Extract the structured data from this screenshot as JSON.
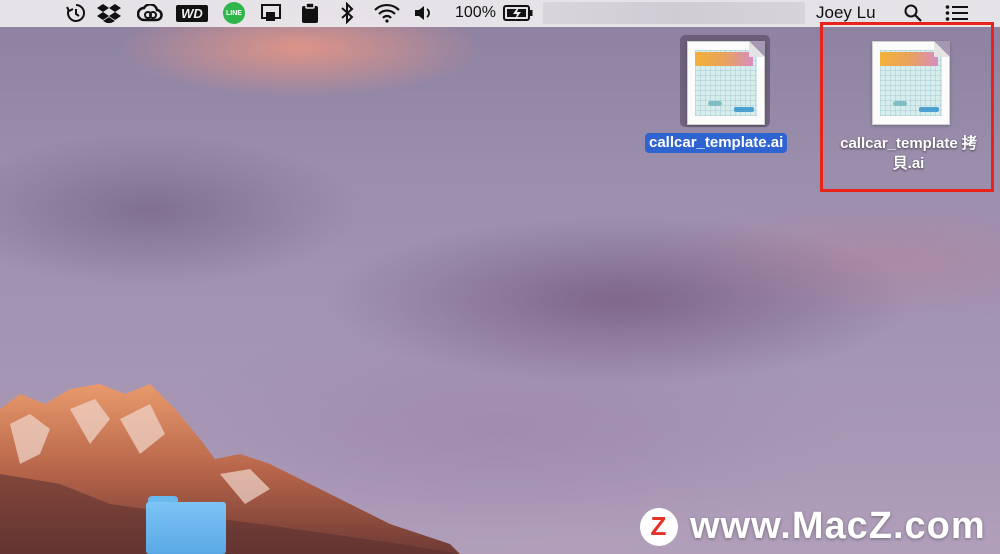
{
  "menubar": {
    "icons": [
      "time-machine-icon",
      "dropbox-icon",
      "creative-cloud-icon",
      "wd-icon",
      "line-icon",
      "airplay-icon",
      "clipboard-icon",
      "bluetooth-icon",
      "wifi-icon",
      "volume-icon",
      "battery-icon"
    ],
    "wd_label": "WD",
    "line_label": "LINE",
    "battery_percent": "100%",
    "user_name": "Joey Lu"
  },
  "desktop": {
    "files": [
      {
        "name": "callcar_template.ai",
        "selected": true
      },
      {
        "name_line1": "callcar_template 拷",
        "name_line2": "貝.ai",
        "selected": false
      }
    ],
    "highlight_color": "#e8231c"
  },
  "watermark": {
    "badge": "Z",
    "text": "www.MacZ.com"
  }
}
